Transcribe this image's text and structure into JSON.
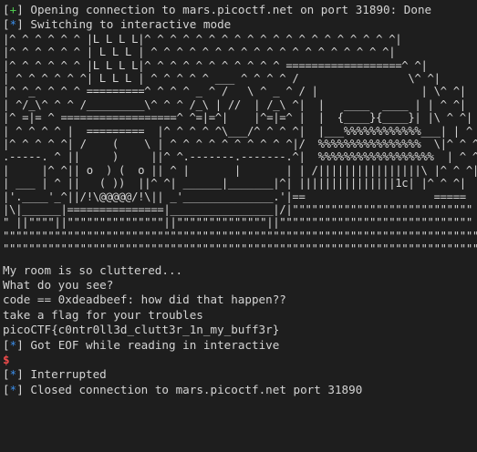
{
  "colors": {
    "background": "#1e1e1e",
    "text": "#d4d4d4",
    "plus_marker": "#4ec94e",
    "star_marker": "#3b8eea",
    "prompt": "#f14c4c"
  },
  "header_lines": [
    {
      "open": "[",
      "marker": "+",
      "close": "]",
      "text": " Opening connection to mars.picoctf.net on port 31890: Done"
    },
    {
      "open": "[",
      "marker": "*",
      "close": "]",
      "text": " Switching to interactive mode"
    }
  ],
  "ascii_art": [
    "|^ ^ ^ ^ ^ ^ |L L L L|^ ^ ^ ^ ^ ^ ^ ^ ^ ^ ^ ^ ^ ^ ^ ^ ^ ^ ^ ^|",
    "|^ ^ ^ ^ ^ ^ | L L L | ^ ^ ^ ^ ^ ^ ^ ^ ^ ^ ^ ^ ^ ^ ^ ^ ^ ^ ^|",
    "|^ ^ ^ ^ ^ ^ |L L L L|^ ^ ^ ^ ^ ^ ^ ^ ^ ^ ^ ==================^ ^|",
    "| ^ ^ ^ ^ ^ ^| L L L | ^ ^ ^ ^ ^ ___ ^ ^ ^ ^ /                 \\^ ^|",
    "|^ ^_^ ^ ^ ^ =========^ ^ ^ ^ _ ^ /   \\ ^ _ ^ / |                | \\^ ^|",
    "| ^/_\\^ ^ ^ /_________\\^ ^ ^ /_\\ | //  | /_\\ ^|  |   ____  ____ | | ^ ^|",
    "|^ =|= ^ ==================^ ^=|=^|    |^=|=^ |  |  {____}{____}| |\\ ^ ^|",
    "| ^ ^ ^ ^ |  =========  |^ ^ ^ ^ ^\\___/^ ^ ^ ^|  |___%%%%%%%%%%%%___| | ^ ^|",
    "|^ ^ ^ ^ ^| /    (    \\ | ^ ^ ^ ^ ^ ^ ^ ^ ^ ^|/  %%%%%%%%%%%%%%%%  \\|^ ^ ^|",
    ".-----. ^ ||     )     ||^ ^.-------.-------.^|  %%%%%%%%%%%%%%%%%%  | ^ ^|",
    "|     |^ ^|| o  ) (  o || ^ |       |       | | /||||||||||||||||\\ |^ ^ ^|",
    "| ___ | ^ ||   ( ))  ||^ ^| ______|_______|^| |||||||||||||||1c| |^ ^ ^|",
    "|'.____'_^||/!\\@@@@@/!\\|| _'______________.'|==                    =====",
    "|\\|______|===============|________________|/|\"\"\"\"\"\"\"\"\"\"\"\"\"\"\"\"\"\"\"\"\"\"\"\"\"\"\"\"",
    "\" ||\"\"\"\"||\"\"\"\"\"\"\"\"\"\"\"\"\"\"\"||\"\"\"\"\"\"\"\"\"\"\"\"\"\"||\"\"\"\"\"\"\"\"\"\"\"\"\"\"\"\"\"\"\"\"\"\"\"\"\"\"\"\"\"\"",
    "\"\"\"\"\"\"\"\"\"\"\"\"\"\"\"\"\"\"\"\"\"\"\"\"\"\"\"\"\"\"\"\"\"\"\"\"\"\"\"\"\"\"\"\"\"\"\"\"\"\"\"\"\"\"\"\"\"\"\"\"\"\"\"\"\"\"\"\"\"\"\"\"\"\"\"",
    "\"\"\"\"\"\"\"\"\"\"\"\"\"\"\"\"\"\"\"\"\"\"\"\"\"\"\"\"\"\"\"\"\"\"\"\"\"\"\"\"\"\"\"\"\"\"\"\"\"\"\"\"\"\"\"\"\"\"\"\"\"\"\"\"\"\"\"\"\"\"\"\"\"\"\"\"\"\""
  ],
  "output_lines": [
    "My room is so cluttered...",
    "What do you see?",
    "code == 0xdeadbeef: how did that happen??",
    "take a flag for your troubles",
    "picoCTF{c0ntr0ll3d_clutt3r_1n_my_buff3r}"
  ],
  "eof_line": {
    "open": "[",
    "marker": "*",
    "close": "]",
    "text": " Got EOF while reading in interactive"
  },
  "prompt": "$",
  "footer_lines": [
    {
      "open": "[",
      "marker": "*",
      "close": "]",
      "text": " Interrupted"
    },
    {
      "open": "[",
      "marker": "*",
      "close": "]",
      "text": " Closed connection to mars.picoctf.net port 31890"
    }
  ]
}
